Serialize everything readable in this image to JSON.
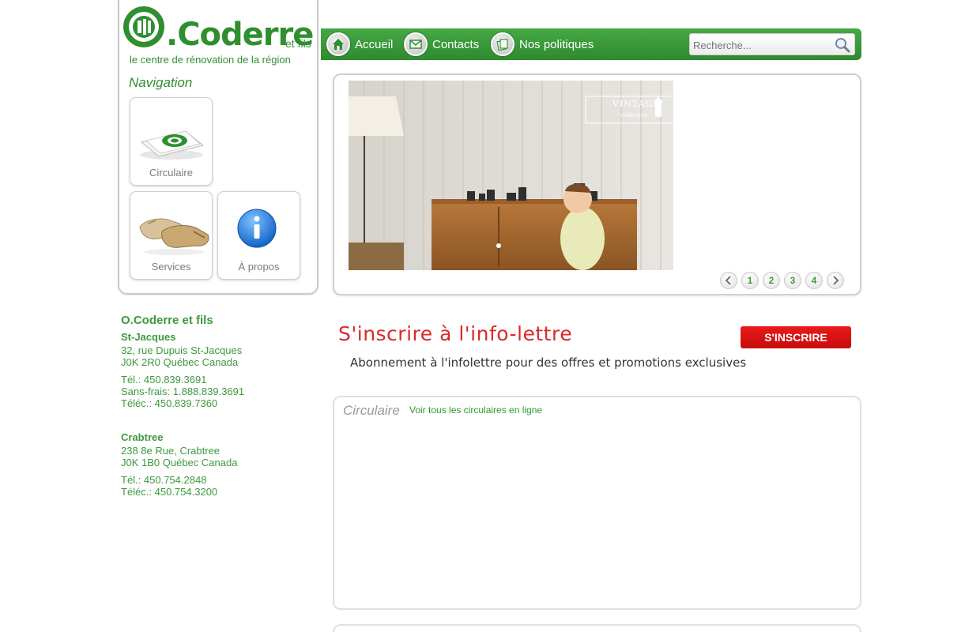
{
  "brand": {
    "name": ".Coderre",
    "suffix": "et fils",
    "tagline": "le centre de rénovation de la région",
    "accent": "#2f8f2f"
  },
  "sidebar": {
    "heading": "Navigation",
    "tiles": [
      {
        "label": "Circulaire",
        "icon": "flyer-icon"
      },
      {
        "label": "Services",
        "icon": "work-gloves-icon"
      },
      {
        "label": "À propos",
        "icon": "info-icon"
      }
    ]
  },
  "topnav": {
    "items": [
      {
        "label": "Accueil",
        "icon": "home-icon"
      },
      {
        "label": "Contacts",
        "icon": "mail-icon"
      },
      {
        "label": "Nos politiques",
        "icon": "documents-icon"
      }
    ],
    "search_placeholder": "Recherche...",
    "bar_color": "#3a9a3a"
  },
  "slider": {
    "image_caption": "VINTAGE",
    "image_caption_sub": "collection",
    "pages": [
      "1",
      "2",
      "3",
      "4"
    ]
  },
  "newsletter": {
    "title": "S'inscrire à l'info-lettre",
    "button_label": "S'INSCRIRE",
    "subtitle": "Abonnement à l'infolettre pour des offres et promotions exclusives",
    "button_color": "#e01212"
  },
  "circulaire": {
    "title": "Circulaire",
    "link_text": "Voir tous les circulaires en ligne"
  },
  "contact": {
    "company": "O.Coderre et fils",
    "branches": [
      {
        "name": "St-Jacques",
        "address1": "32, rue Dupuis St-Jacques",
        "address2": "J0K 2R0 Québec Canada",
        "phone": "Tél.: 450.839.3691",
        "tollfree": "Sans-frais: 1.888.839.3691",
        "fax": "Téléc.: 450.839.7360"
      },
      {
        "name": "Crabtree",
        "address1": "238 8e Rue, Crabtree",
        "address2": "J0K 1B0 Québec Canada",
        "phone": "Tél.: 450.754.2848",
        "fax": "Téléc.: 450.754.3200"
      }
    ]
  }
}
